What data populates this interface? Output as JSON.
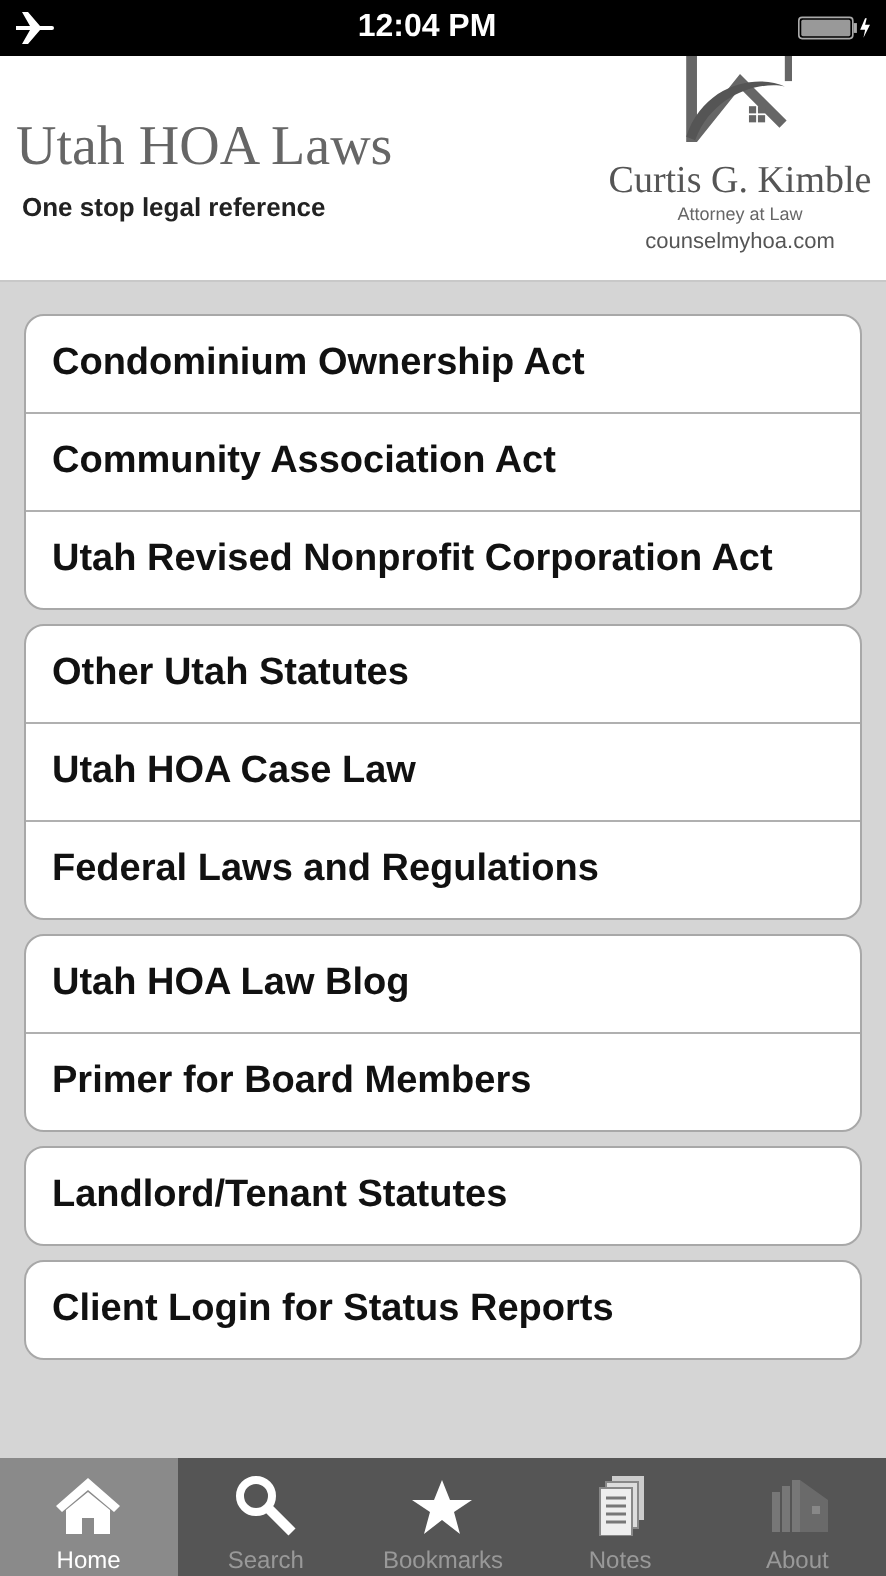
{
  "status_bar": {
    "time": "12:04 PM"
  },
  "header": {
    "title": "Utah HOA Laws",
    "subtitle": "One stop legal reference",
    "logo": {
      "name": "Curtis G. Kimble",
      "role": "Attorney at Law",
      "site": "counselmyhoa.com"
    }
  },
  "groups": [
    {
      "items": [
        "Condominium Ownership Act",
        "Community Association Act",
        "Utah Revised Nonprofit Corporation Act"
      ]
    },
    {
      "items": [
        "Other Utah Statutes",
        "Utah HOA Case Law",
        "Federal Laws and Regulations"
      ]
    },
    {
      "items": [
        "Utah HOA Law Blog",
        "Primer for Board Members"
      ]
    },
    {
      "items": [
        "Landlord/Tenant Statutes"
      ]
    },
    {
      "items": [
        "Client Login for Status Reports"
      ]
    }
  ],
  "tabs": [
    {
      "label": "Home",
      "kind": "home",
      "selected": true
    },
    {
      "label": "Search",
      "kind": "search",
      "selected": false
    },
    {
      "label": "Bookmarks",
      "kind": "star",
      "selected": false
    },
    {
      "label": "Notes",
      "kind": "notes",
      "selected": false
    },
    {
      "label": "About",
      "kind": "building",
      "selected": false
    }
  ]
}
